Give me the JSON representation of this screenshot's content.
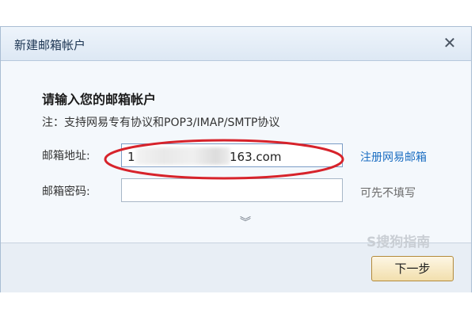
{
  "dialog": {
    "title": "新建邮箱帐户",
    "close_glyph": "✕",
    "heading": "请输入您的邮箱帐户",
    "note": "注：支持网易专有协议和POP3/IMAP/SMTP协议",
    "email_label": "邮箱地址:",
    "email_value_prefix": "1",
    "email_value_domain": "163.com",
    "register_link": "注册网易邮箱",
    "password_label": "邮箱密码:",
    "password_value": "",
    "password_hint": "可先不填写",
    "expand_glyph": "︾",
    "next_button": "下一步"
  },
  "watermark": "S搜狗指南",
  "colors": {
    "highlight_ellipse": "#d7232b",
    "link": "#1b6ec2",
    "button_border": "#b38a3a"
  },
  "icons": {
    "close": "close-icon",
    "expand": "double-chevron-down-icon"
  }
}
